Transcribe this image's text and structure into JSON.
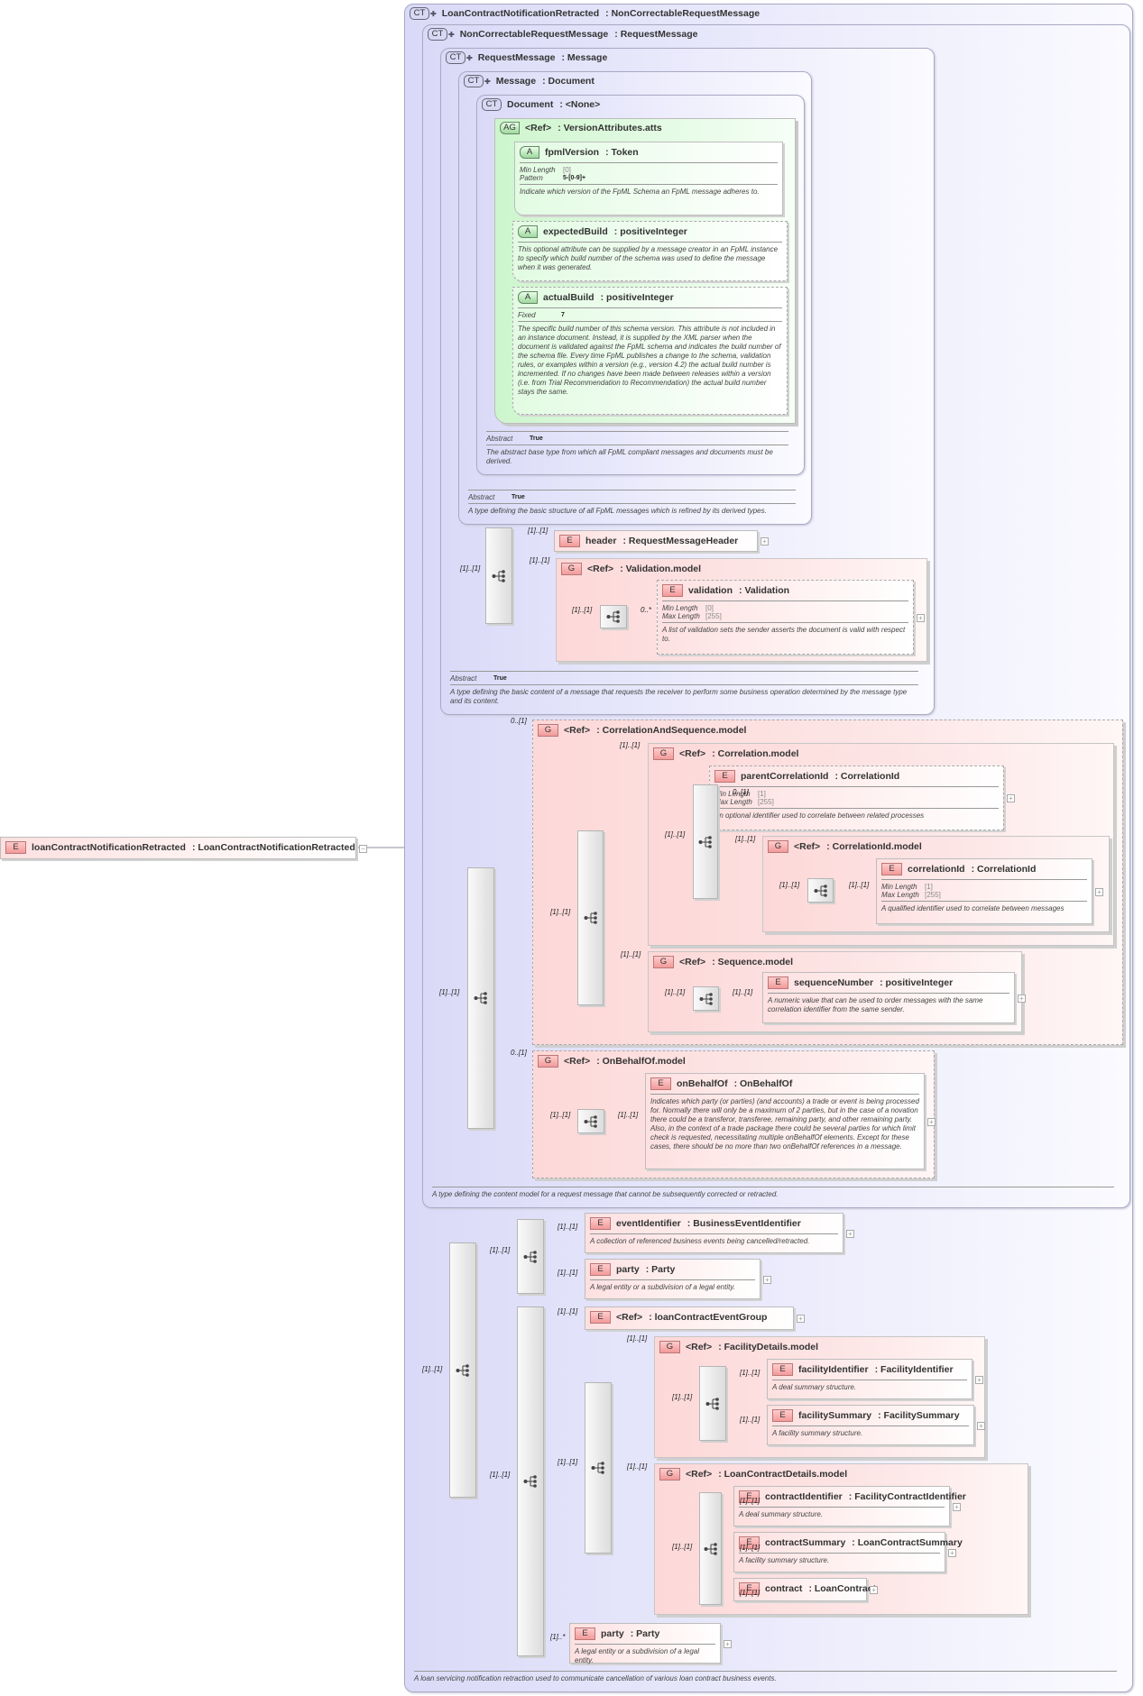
{
  "nodes": {
    "root": {
      "badge": "E",
      "name": "loanContractNotificationRetracted",
      "type": "LoanContractNotificationRetracted"
    },
    "ct1": {
      "badge": "CT",
      "plus": "✚",
      "name": "LoanContractNotificationRetracted",
      "type": "NonCorrectableRequestMessage",
      "description": "A loan servicing notification retraction used to communicate cancellation of various loan contract business events."
    },
    "ct2": {
      "badge": "CT",
      "plus": "✚",
      "name": "NonCorrectableRequestMessage",
      "type": "RequestMessage",
      "description": "A type defining the content model for a request message that cannot be subsequently corrected or retracted."
    },
    "ct3": {
      "badge": "CT",
      "plus": "✚",
      "name": "RequestMessage",
      "type": "Message",
      "facets": [
        {
          "label": "Abstract",
          "value": "True"
        }
      ],
      "description": "A type defining the basic content of a message that requests the receiver to perform some business operation determined by the message type and its content."
    },
    "ct4": {
      "badge": "CT",
      "plus": "✚",
      "name": "Message",
      "type": "Document",
      "facets": [
        {
          "label": "Abstract",
          "value": "True"
        }
      ],
      "description": "A type defining the basic structure of all FpML messages which is refined by its derived types."
    },
    "ct5": {
      "badge": "CT",
      "name": "Document",
      "type": "<None>",
      "facets": [
        {
          "label": "Abstract",
          "value": "True"
        }
      ],
      "description": "The abstract base type from which all FpML compliant messages and documents must be derived."
    },
    "ag": {
      "badge": "AG",
      "name": "<Ref>",
      "type": "VersionAttributes.atts"
    },
    "a1": {
      "badge": "A",
      "name": "fpmlVersion",
      "type": "Token",
      "facets": [
        {
          "label": "Min Length",
          "value": "[0]"
        },
        {
          "label": "Pattern",
          "value": "5-[0-9]+"
        }
      ],
      "description": "Indicate which version of the FpML Schema an FpML message adheres to."
    },
    "a2": {
      "badge": "A",
      "name": "expectedBuild",
      "type": "positiveInteger",
      "description": "This optional attribute can be supplied by a message creator in an FpML instance to specify which build number of the schema was used to define the message when it was generated."
    },
    "a3": {
      "badge": "A",
      "name": "actualBuild",
      "type": "positiveInteger",
      "facets": [
        {
          "label": "Fixed",
          "value": "7"
        }
      ],
      "description": "The specific build number of this schema version. This attribute is not included in an instance document. Instead, it is supplied by the XML parser when the document is validated against the FpML schema and indicates the build number of the schema file. Every time FpML publishes a change to the schema, validation rules, or examples within a version (e.g., version 4.2) the actual build number is incremented. If no changes have been made between releases within a version (i.e. from Trial Recommendation to Recommendation) the actual build number stays the same."
    },
    "header": {
      "badge": "E",
      "name": "header",
      "type": "RequestMessageHeader"
    },
    "gval": {
      "badge": "G",
      "name": "<Ref>",
      "type": "Validation.model"
    },
    "validation": {
      "badge": "E",
      "name": "validation",
      "type": "Validation",
      "facets": [
        {
          "label": "Min Length",
          "value": "[0]"
        },
        {
          "label": "Max Length",
          "value": "[255]"
        }
      ],
      "description": "A list of validation sets the sender asserts the document is valid with respect to."
    },
    "gcas": {
      "badge": "G",
      "name": "<Ref>",
      "type": "CorrelationAndSequence.model"
    },
    "gcorr": {
      "badge": "G",
      "name": "<Ref>",
      "type": "Correlation.model"
    },
    "parentCorrelationId": {
      "badge": "E",
      "name": "parentCorrelationId",
      "type": "CorrelationId",
      "facets": [
        {
          "label": "Min Length",
          "value": "[1]"
        },
        {
          "label": "Max Length",
          "value": "[255]"
        }
      ],
      "description": "An optional identifier used to correlate between related processes"
    },
    "gcorrid": {
      "badge": "G",
      "name": "<Ref>",
      "type": "CorrelationId.model"
    },
    "correlationId": {
      "badge": "E",
      "name": "correlationId",
      "type": "CorrelationId",
      "facets": [
        {
          "label": "Min Length",
          "value": "[1]"
        },
        {
          "label": "Max Length",
          "value": "[255]"
        }
      ],
      "description": "A qualified identifier used to correlate between messages"
    },
    "gseq": {
      "badge": "G",
      "name": "<Ref>",
      "type": "Sequence.model"
    },
    "sequenceNumber": {
      "badge": "E",
      "name": "sequenceNumber",
      "type": "positiveInteger",
      "description": "A numeric value that can be used to order messages with the same correlation identifier from the same sender."
    },
    "gobo": {
      "badge": "G",
      "name": "<Ref>",
      "type": "OnBehalfOf.model"
    },
    "onBehalfOf": {
      "badge": "E",
      "name": "onBehalfOf",
      "type": "OnBehalfOf",
      "description": "Indicates which party (or parties) (and accounts) a trade or event is being processed for. Normally there will only be a maximum of 2 parties, but in the case of a novation there could be a transferor, transferee, remaining party, and other remaining party. Also, in the context of a trade package there could be several parties for which limit check is requested, necessitating multiple onBehalfOf elements. Except for these cases, there should be no more than two onBehalfOf references in a message."
    },
    "eventIdentifier": {
      "badge": "E",
      "name": "eventIdentifier",
      "type": "BusinessEventIdentifier",
      "description": "A collection of referenced business events being cancelled/retracted."
    },
    "party1": {
      "badge": "E",
      "name": "party",
      "type": "Party",
      "description": "A legal entity or a subdivision of a legal entity."
    },
    "refgroup": {
      "badge": "E",
      "name": "<Ref>",
      "type": "loanContractEventGroup"
    },
    "gfd": {
      "badge": "G",
      "name": "<Ref>",
      "type": "FacilityDetails.model"
    },
    "facilityIdentifier": {
      "badge": "E",
      "name": "facilityIdentifier",
      "type": "FacilityIdentifier",
      "description": "A deal summary structure."
    },
    "facilitySummary": {
      "badge": "E",
      "name": "facilitySummary",
      "type": "FacilitySummary",
      "description": "A facility summary structure."
    },
    "glcd": {
      "badge": "G",
      "name": "<Ref>",
      "type": "LoanContractDetails.model"
    },
    "contractIdentifier": {
      "badge": "E",
      "name": "contractIdentifier",
      "type": "FacilityContractIdentifier",
      "description": "A deal summary structure."
    },
    "contractSummary": {
      "badge": "E",
      "name": "contractSummary",
      "type": "LoanContractSummary",
      "description": "A facility summary structure."
    },
    "contract": {
      "badge": "E",
      "name": "contract",
      "type": "LoanContract"
    },
    "party2": {
      "badge": "E",
      "name": "party",
      "type": "Party",
      "description": "A legal entity or a subdivision of a legal entity."
    }
  },
  "expander": {
    "collapsed": "+",
    "expanded": "−"
  },
  "cardinalities": [
    "[1]..[1]",
    "[1]..[1]",
    "[1]..[1]",
    "[1]..[1]",
    "0..*",
    "0..[1]",
    "[1]..[1]",
    "[1]..[1]",
    "[1]..[1]",
    "0..[1]",
    "[1]..[1]",
    "[1]..[1]",
    "[1]..[1]",
    "[1]..[1]",
    "[1]..[1]",
    "[1]..[1]",
    "0..[1]",
    "[1]..[1]",
    "[1]..[1]",
    "[1]..[1]",
    "[1]..[1]",
    "[1]..[1]",
    "[1]..[1]",
    "[1]..[1]",
    "[1]..[1]",
    "[1]..[1]",
    "[1]..[1]",
    "[1]..[1]",
    "[1]..[1]",
    "[1]..[1]",
    "[1]..[1]",
    "[1]..[1]",
    "[1]..[1]",
    "[1]..[1]",
    "[1]..[1]",
    "[1]..[1]",
    "[1]..*"
  ]
}
